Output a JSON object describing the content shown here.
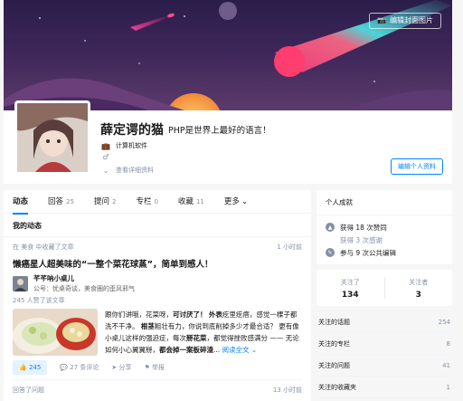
{
  "profile": {
    "edit_cover_label": "编辑封面图片",
    "name": "薛定谔的猫",
    "headline": "PHP是世界上最好的语言！",
    "industry": "计算机软件",
    "view_details": "查看详细资料",
    "edit_profile_label": "编辑个人资料"
  },
  "tabs": [
    {
      "label": "动态",
      "count": ""
    },
    {
      "label": "回答",
      "count": "25"
    },
    {
      "label": "提问",
      "count": "2"
    },
    {
      "label": "专栏",
      "count": "0"
    },
    {
      "label": "收藏",
      "count": "11"
    },
    {
      "label": "更多",
      "count": ""
    }
  ],
  "section_title": "我的动态",
  "feed": {
    "item1": {
      "meta_left": "在 美食 中收藏了文章",
      "meta_right": "1 小时前",
      "title": "懒癌星人超美味的“一整个菜花球蒸”，简单到感人！",
      "author_name": "芊芊呐小桌儿",
      "author_desc": "公号：忧桌奇谈，美食圈的歪风邪气",
      "likes_line": "245 人赞了该文章",
      "excerpt_p1": "跟你们讲哦，花菜呀，",
      "excerpt_b1": "可讨厌了！",
      "excerpt_p2": "外表",
      "excerpt_p3": "疙里疙瘩，感觉一棵子都洗不干净。",
      "excerpt_b2": "根茎",
      "excerpt_p4": "粗壮有力，你说到底削掉多少才最合适？ 更有像小桌儿这样的强迫症，每次",
      "excerpt_b3": "掰花菜",
      "excerpt_p5": "，都觉得挫败感满分 —— 无论如何小心翼翼掰，",
      "excerpt_b4": "都会掉一案板碎渣",
      "excerpt_p6": "...",
      "read_more": "阅读全文",
      "vote_count": "245",
      "comments": "27 条评论",
      "share": "分享",
      "report": "举报"
    },
    "item2": {
      "meta_left": "回答了问题",
      "meta_right": "13 小时前"
    }
  },
  "sidebar": {
    "achievements_title": "个人成就",
    "achievements": {
      "likes": "获得 18 次赞同",
      "thanks": "获得 3 次感谢",
      "edits": "参与 9 次公共编辑"
    },
    "following_label": "关注了",
    "following_count": "134",
    "followers_label": "关注者",
    "followers_count": "3",
    "lists": [
      {
        "label": "关注的话题",
        "value": "254"
      },
      {
        "label": "关注的专栏",
        "value": "8"
      },
      {
        "label": "关注的问题",
        "value": "41"
      },
      {
        "label": "关注的收藏夹",
        "value": "1"
      }
    ]
  },
  "colors": {
    "accent": "#0084ff",
    "cover_bg": "#2a1d4a"
  }
}
